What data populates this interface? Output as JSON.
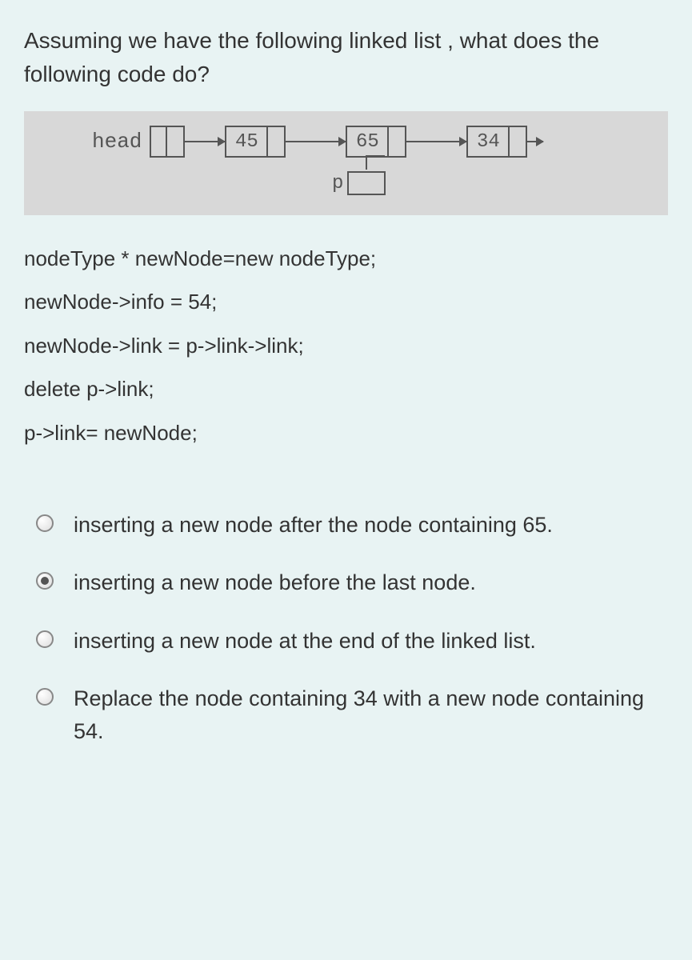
{
  "question": "Assuming we have the following linked list , what does the following code do?",
  "diagram": {
    "head_label": "head",
    "nodes": [
      "45",
      "65",
      "34"
    ],
    "p_label": "p"
  },
  "code": {
    "line1": "nodeType * newNode=new nodeType;",
    "line2": "newNode->info = 54;",
    "line3": "newNode->link = p->link->link;",
    "line4": "delete p->link;",
    "line5": "p->link= newNode;"
  },
  "options": {
    "a": "inserting a new node after the node containing 65.",
    "b": "inserting a new node before the last node.",
    "c": "inserting a new node at the end of the linked list.",
    "d": "Replace the node containing 34 with a new node containing 54."
  },
  "selected": "b"
}
